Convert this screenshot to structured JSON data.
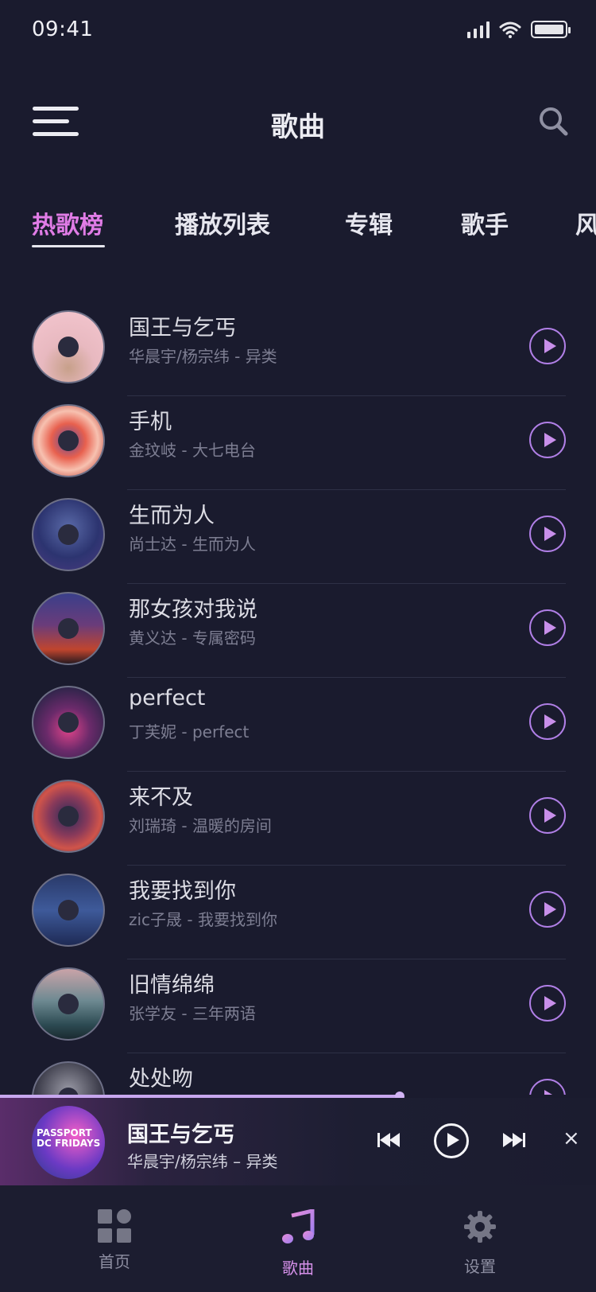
{
  "status": {
    "time": "09:41"
  },
  "header": {
    "title": "歌曲"
  },
  "tabs": [
    "热歌榜",
    "播放列表",
    "专辑",
    "歌手",
    "风"
  ],
  "songs": [
    {
      "title": "国王与乞丐",
      "artist": "华晨宇/杨宗纬",
      "album": "异类"
    },
    {
      "title": "手机",
      "artist": "金玟岐",
      "album": "大七电台"
    },
    {
      "title": "生而为人",
      "artist": "尚士达",
      "album": "生而为人"
    },
    {
      "title": "那女孩对我说",
      "artist": "黄义达",
      "album": "专属密码"
    },
    {
      "title": "perfect",
      "artist": "丁芙妮",
      "album": "perfect"
    },
    {
      "title": "来不及",
      "artist": "刘瑞琦",
      "album": "温暖的房间"
    },
    {
      "title": "我要找到你",
      "artist": "zic子晟",
      "album": "我要找到你"
    },
    {
      "title": "旧情绵绵",
      "artist": "张学友",
      "album": "三年两语"
    },
    {
      "title": "处处吻",
      "artist": "",
      "album": ""
    }
  ],
  "separator": " - ",
  "player": {
    "title": "国王与乞丐",
    "subtitle": "华晨宇/杨宗纬 – 异类",
    "progress": 0.67,
    "close": "×",
    "cover_text": "PASSPORT DC FRIDAYS"
  },
  "nav": [
    {
      "label": "首页",
      "icon": "home-grid-icon"
    },
    {
      "label": "歌曲",
      "icon": "music-note-icon"
    },
    {
      "label": "设置",
      "icon": "gear-icon"
    }
  ],
  "colors": {
    "accent": "#e07ce6",
    "background": "#1a1b2e",
    "play": "#b07fe6"
  }
}
